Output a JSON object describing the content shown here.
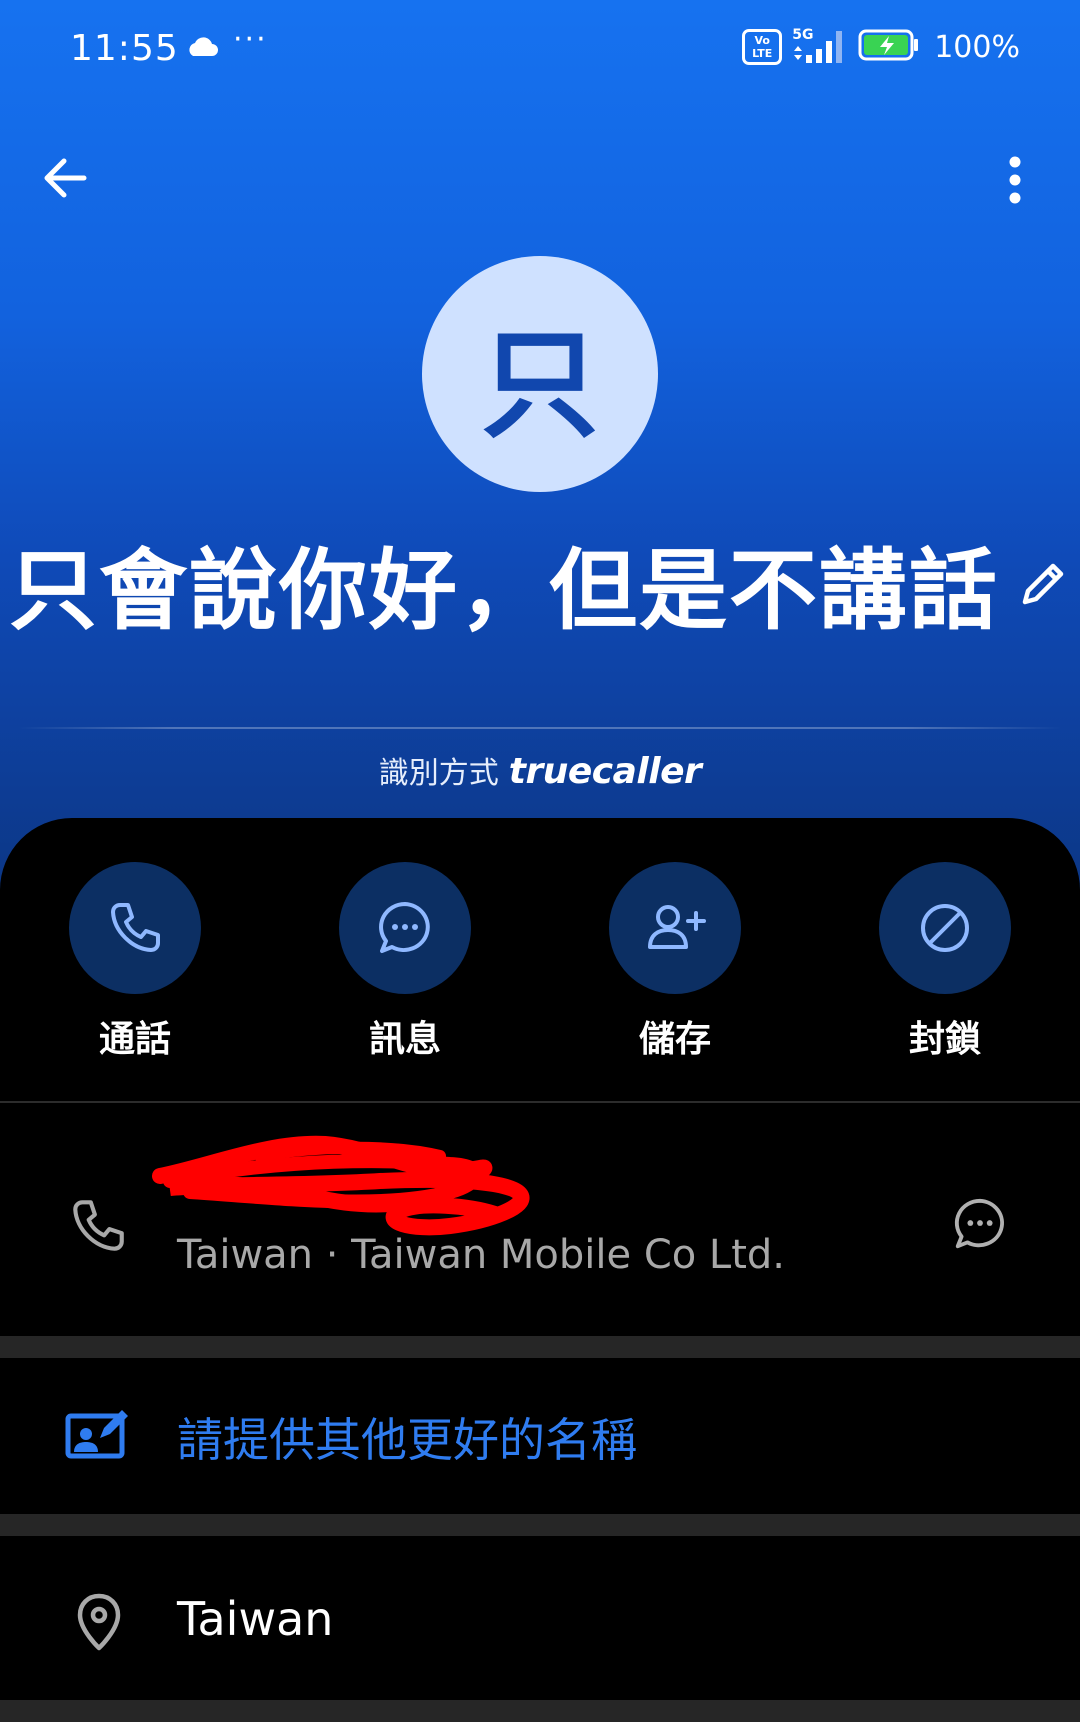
{
  "status_bar": {
    "time": "11:55",
    "more": "···",
    "volte_top": "Vo",
    "volte_bottom": "LTE",
    "network": "5G",
    "battery_percent": "100%"
  },
  "header": {
    "avatar_initial": "只",
    "contact_name": "只會說你好，但是不講話",
    "identified_by": "識別方式",
    "brand": "truecaller"
  },
  "actions": [
    {
      "label": "通話",
      "icon": "phone-icon"
    },
    {
      "label": "訊息",
      "icon": "chat-bubble-icon"
    },
    {
      "label": "儲存",
      "icon": "add-person-icon"
    },
    {
      "label": "封鎖",
      "icon": "block-icon"
    }
  ],
  "phone_entry": {
    "carrier": "Taiwan · Taiwan Mobile Co Ltd."
  },
  "suggest": {
    "label": "請提供其他更好的名稱"
  },
  "location": {
    "label": "Taiwan"
  },
  "colors": {
    "header_top": "#1672f0",
    "header_bottom": "#0c3684",
    "avatar_bg": "#cfe1ff",
    "action_circle": "#0c2f63",
    "accent_link": "#2f7cf0",
    "redaction": "#ff0000"
  }
}
